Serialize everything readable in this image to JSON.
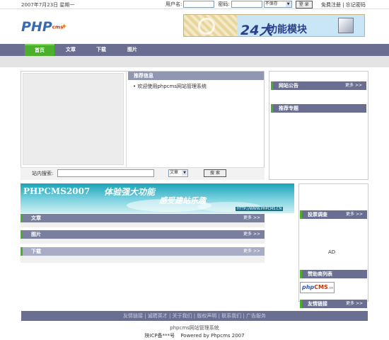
{
  "topbar": {
    "date": "2007年7月23日 星期一",
    "username_label": "用户名:",
    "password_label": "密码:",
    "remember_option": "不保存",
    "login_button": "登 录",
    "register_link": "免费注册",
    "forgot_link": "忘记密码"
  },
  "logo": {
    "text": "PHP",
    "sub": "cms"
  },
  "top_banner": {
    "big": "24大",
    "title": "功能模块"
  },
  "nav": {
    "items": [
      {
        "label": "首页"
      },
      {
        "label": "文章"
      },
      {
        "label": "下载"
      },
      {
        "label": "图片"
      }
    ]
  },
  "recommend": {
    "title": "推荐信息",
    "items": [
      "• 欢迎使用phpcms网站管理系统"
    ]
  },
  "search": {
    "label": "站内搜索:",
    "category": "文章",
    "button": "搜 索"
  },
  "right_top": {
    "announcement": "网站公告",
    "more": "更多 >>",
    "topics": "推荐专题"
  },
  "wide_banner": {
    "title": "PHPCMS2007",
    "slogan1": "体验强大功能",
    "slogan2": "感受建站乐趣",
    "url": "HTTP://WWW.PHPCMS.CN"
  },
  "sections": [
    {
      "title": "文章",
      "more": "更多 >>"
    },
    {
      "title": "图片",
      "more": "更多 >>"
    },
    {
      "title": "下载",
      "more": "更多 >>"
    }
  ],
  "sidebar": {
    "poll": {
      "title": "投票调查",
      "more": "更多 >>"
    },
    "sponsors": {
      "title": "赞助商列表",
      "ad": "AD"
    },
    "links": {
      "title": "友情链接",
      "more": "更多 >>"
    },
    "link_logo": {
      "php": "php",
      "cms": "CMS",
      "cn": ".cn"
    }
  },
  "footer": {
    "links": "友情链接 | 诚聘英才 | 关于我们 | 版权声明 | 联系我们 | 广告服务",
    "system": "phpcms网站管理系统",
    "icp": "陕ICP备***号",
    "powered": "Powered by Phpcms 2007"
  },
  "colors": {
    "nav": "#6a6f92",
    "active": "#4caf2c",
    "boxhead": "#9097b2"
  }
}
